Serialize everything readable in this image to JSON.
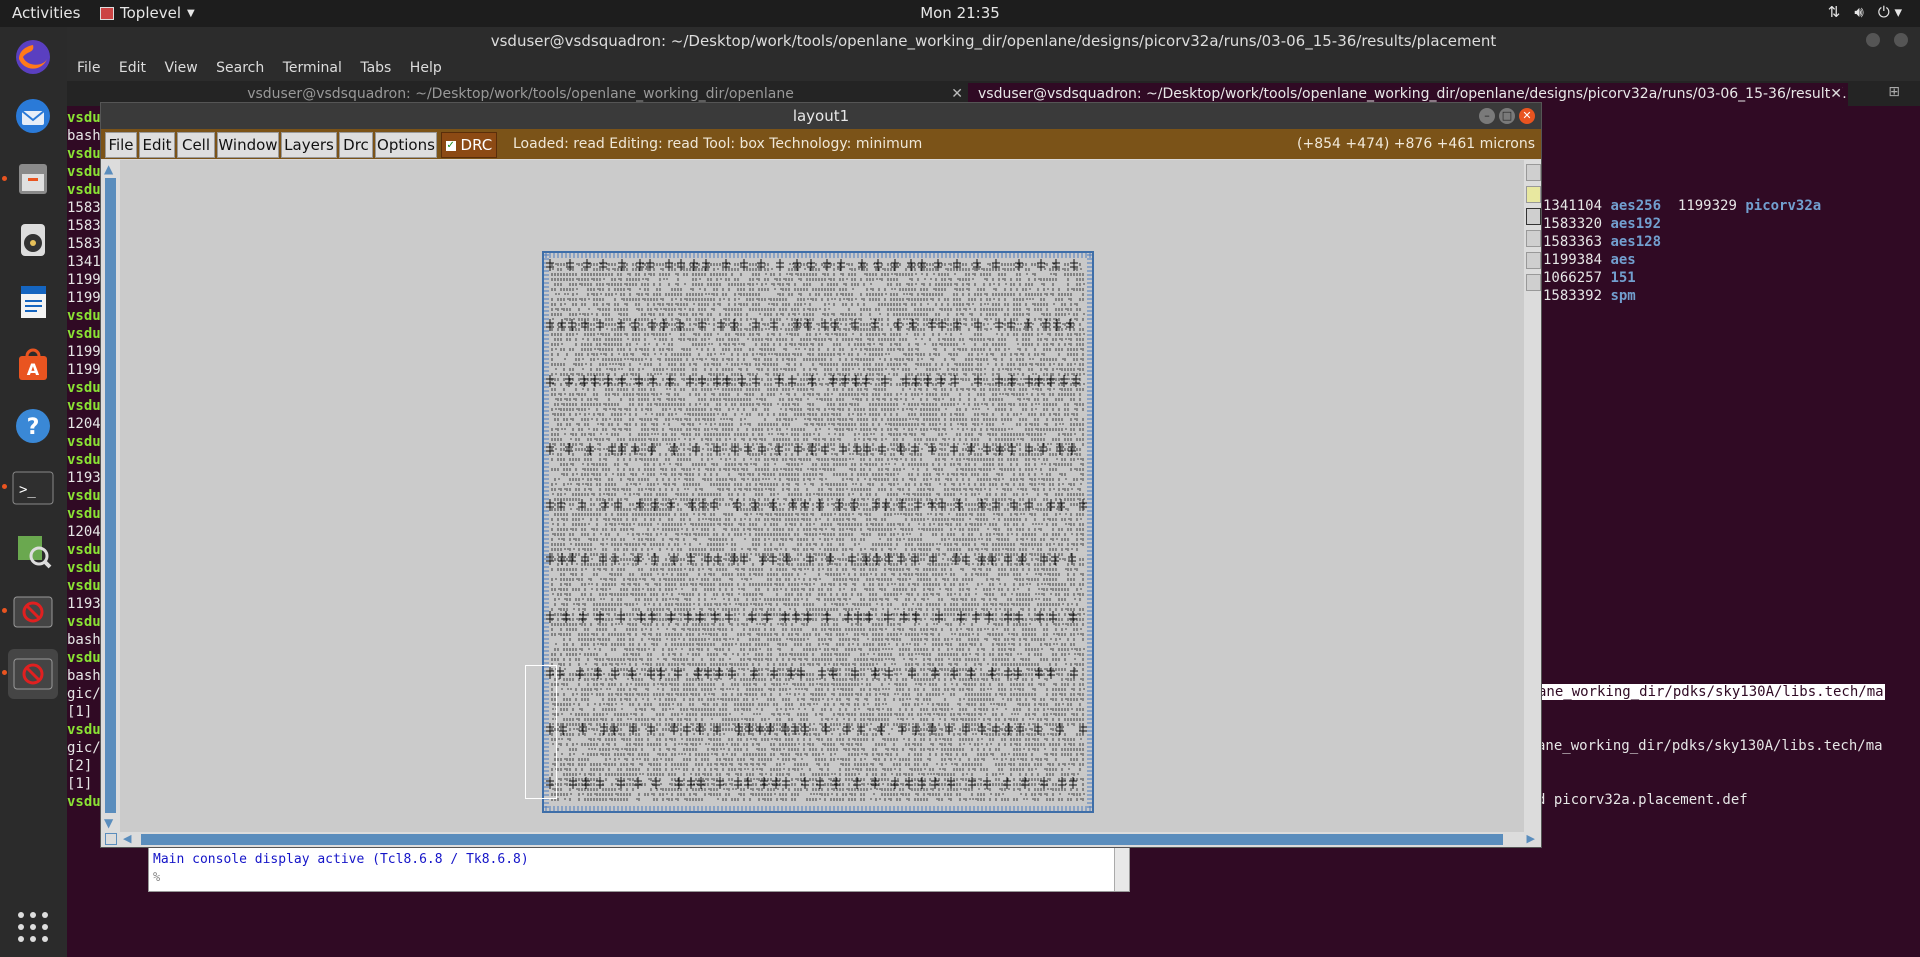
{
  "topbar": {
    "activities": "Activities",
    "app_name": "Toplevel",
    "clock": "Mon 21:35",
    "tray_icons": [
      "network-icon",
      "volume-icon",
      "power-icon"
    ]
  },
  "dock": {
    "items": [
      "firefox-icon",
      "thunderbird-icon",
      "files-icon",
      "rhythmbox-icon",
      "writer-icon",
      "software-center-icon",
      "help-icon",
      "terminal-icon",
      "image-viewer-icon",
      "blocked-app-icon",
      "blocked-app-icon",
      "show-apps-icon"
    ]
  },
  "terminal": {
    "title": "vsduser@vsdsquadron: ~/Desktop/work/tools/openlane_working_dir/openlane/designs/picorv32a/runs/03-06_15-36/results/placement",
    "menu": [
      "File",
      "Edit",
      "View",
      "Search",
      "Terminal",
      "Tabs",
      "Help"
    ],
    "tab1": "vsduser@vsdsquadron: ~/Desktop/work/tools/openlane_working_dir/openlane",
    "tab2": "vsduser@vsdsquadron: ~/Desktop/work/tools/openlane_working_dir/openlane/designs/picorv32a/runs/03-06_15-36/results/...",
    "left_lines": [
      "vsdu",
      "bash",
      "vsdu",
      "vsdu",
      "vsdu",
      "1583",
      "1583",
      "1583",
      "1341",
      "1199",
      "1199",
      "vsdu",
      "vsdu",
      "1199",
      "1199",
      "vsdu",
      "vsdu",
      "1204",
      "vsdu",
      "vsdu",
      "1193",
      "vsdu",
      "vsdu",
      "1204",
      "vsdu",
      "vsdu",
      "vsdu",
      "1193",
      "vsdu",
      "bash",
      "vsdu",
      "bash",
      "gic/",
      "[1]",
      "vsdu",
      "gic/",
      "[2]",
      "[1]",
      "vsdu"
    ],
    "processes": [
      {
        "pid": "1341104",
        "name": "aes256",
        "pid2": "1199329",
        "name2": "picorv32a"
      },
      {
        "pid": "1583320",
        "name": "aes192"
      },
      {
        "pid": "1583363",
        "name": "aes128"
      },
      {
        "pid": "1199384",
        "name": "aes"
      },
      {
        "pid": "1066257",
        "name": "151"
      },
      {
        "pid": "1583392",
        "name": "spm"
      }
    ],
    "right_line1": "ane_working_dir/pdks/sky130A/libs.tech/ma",
    "right_line2": "ane_working_dir/pdks/sky130A/libs.tech/ma",
    "right_line3": "d picorv32a.placement.def"
  },
  "tkcon": {
    "line1": "Main console display active (Tcl8.6.8 / Tk8.6.8)",
    "prompt": "%"
  },
  "layout": {
    "title": "layout1",
    "menu": [
      "File",
      "Edit",
      "Cell",
      "Window",
      "Layers",
      "Drc",
      "Options"
    ],
    "drc_label": "DRC",
    "status": "Loaded: read Editing: read Tool: box  Technology: minimum",
    "coords": "(+854 +474) +876 +461 microns"
  }
}
